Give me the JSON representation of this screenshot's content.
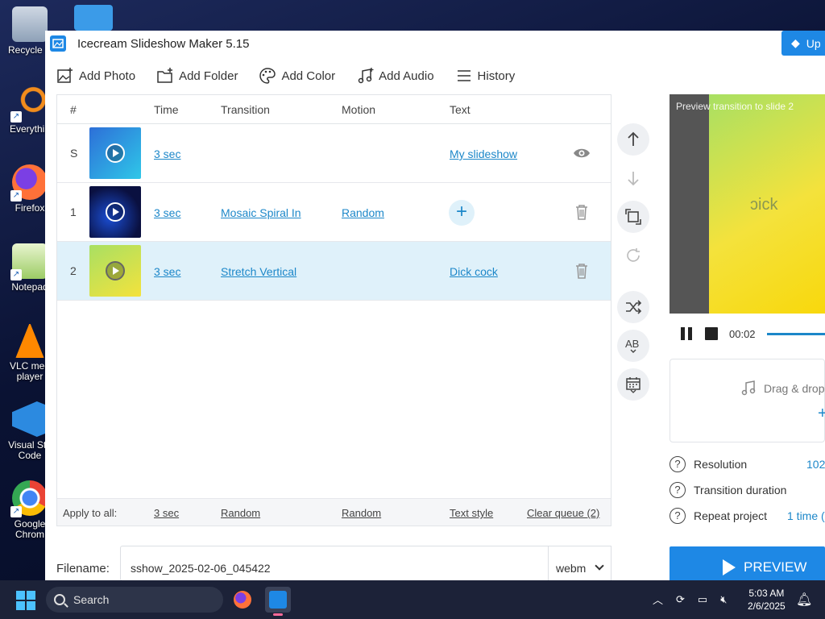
{
  "desktop": {
    "icons": [
      {
        "label": "Recycle B"
      },
      {
        "label": "Everythin"
      },
      {
        "label": "Firefox"
      },
      {
        "label": "Notepad"
      },
      {
        "label": "VLC med player"
      },
      {
        "label": "Visual Stu Code"
      },
      {
        "label": "Google Chrom"
      }
    ]
  },
  "window": {
    "title": "Icecream Slideshow Maker 5.15",
    "upgrade_label": "Up"
  },
  "toolbar": {
    "add_photo": "Add Photo",
    "add_folder": "Add Folder",
    "add_color": "Add Color",
    "add_audio": "Add Audio",
    "history": "History"
  },
  "table": {
    "headers": {
      "num": "#",
      "time": "Time",
      "transition": "Transition",
      "motion": "Motion",
      "text": "Text"
    },
    "rows": [
      {
        "num": "S",
        "time": "3 sec",
        "transition": "",
        "motion": "",
        "text": "My slideshow",
        "action": "eye-icon",
        "thumb_colors": [
          "#2d6fd8",
          "#2fc7e8"
        ],
        "selected": false
      },
      {
        "num": "1",
        "time": "3 sec",
        "transition": "Mosaic Spiral In",
        "motion": "Random",
        "text": "",
        "action": "trash-icon",
        "thumb_colors": [
          "#0a1040",
          "#1b4fd6"
        ],
        "selected": false
      },
      {
        "num": "2",
        "time": "3 sec",
        "transition": "Stretch Vertical",
        "motion": "",
        "text": "Dick cock",
        "action": "trash-icon",
        "thumb_colors": [
          "#a8e063",
          "#f4e23c"
        ],
        "selected": true
      }
    ],
    "footer": {
      "apply_label": "Apply to all:",
      "time": "3 sec",
      "transition": "Random",
      "motion": "Random",
      "text_style": "Text style",
      "clear_queue": "Clear queue (2)"
    }
  },
  "preview": {
    "caption": "Preview transition to slide 2",
    "overlay_text": "ɔick",
    "time": "00:02"
  },
  "audio": {
    "drop_label": "Drag & drop"
  },
  "settings": {
    "resolution_label": "Resolution",
    "resolution_value": "102",
    "transition_duration_label": "Transition duration",
    "repeat_label": "Repeat project",
    "repeat_value": "1 time ("
  },
  "preview_button": "PREVIEW",
  "filename": {
    "label": "Filename:",
    "value": "sshow_2025-02-06_045422",
    "format": "webm"
  },
  "taskbar": {
    "search_placeholder": "Search",
    "time": "5:03 AM",
    "date": "2/6/2025"
  },
  "colors": {
    "accent": "#1e88e5",
    "link": "#1c87c9",
    "selected_row": "#dff1fa"
  }
}
